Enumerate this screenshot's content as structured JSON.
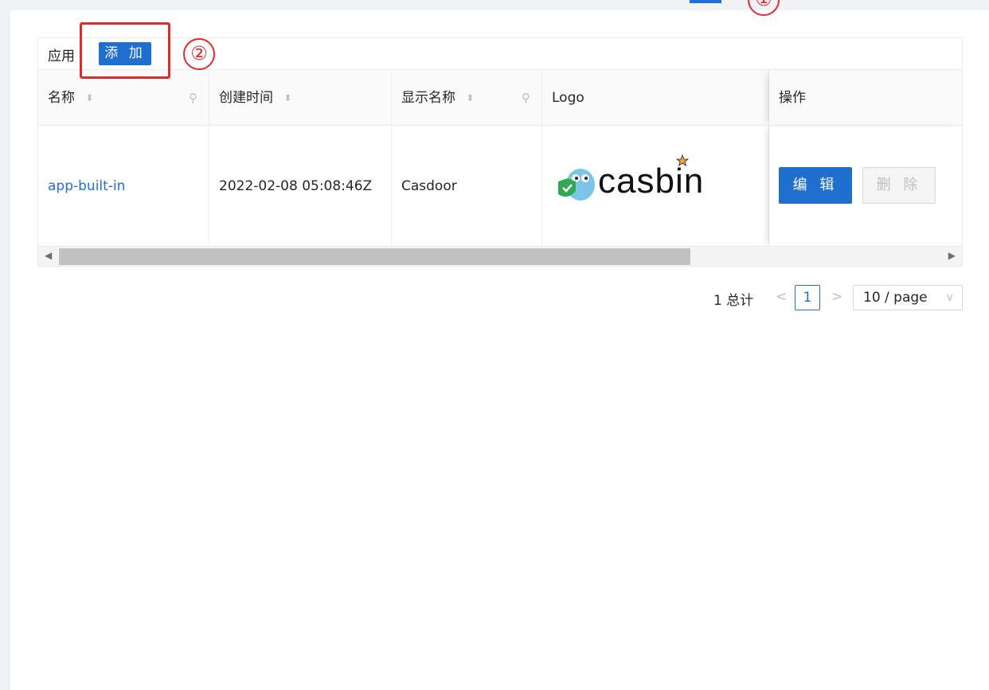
{
  "annotations": {
    "step1": "①",
    "step2": "②"
  },
  "table": {
    "title": "应用",
    "add_label": "添 加",
    "columns": {
      "name": "名称",
      "created_time": "创建时间",
      "display_name": "显示名称",
      "logo": "Logo",
      "actions": "操作"
    },
    "rows": [
      {
        "name": "app-built-in",
        "created_time": "2022-02-08 05:08:46Z",
        "display_name": "Casdoor",
        "logo_text": "casbin",
        "edit_label": "编 辑",
        "delete_label": "删 除"
      }
    ]
  },
  "pagination": {
    "total": "1 总计",
    "current_page": "1",
    "page_size": "10 / page"
  },
  "icons": {
    "sort": "sort-icon",
    "search": "search-icon",
    "prev": "chevron-left-icon",
    "next": "chevron-right-icon",
    "dropdown": "chevron-down-icon"
  },
  "colors": {
    "primary": "#1f6fd1",
    "annotation": "#e02b2b"
  }
}
